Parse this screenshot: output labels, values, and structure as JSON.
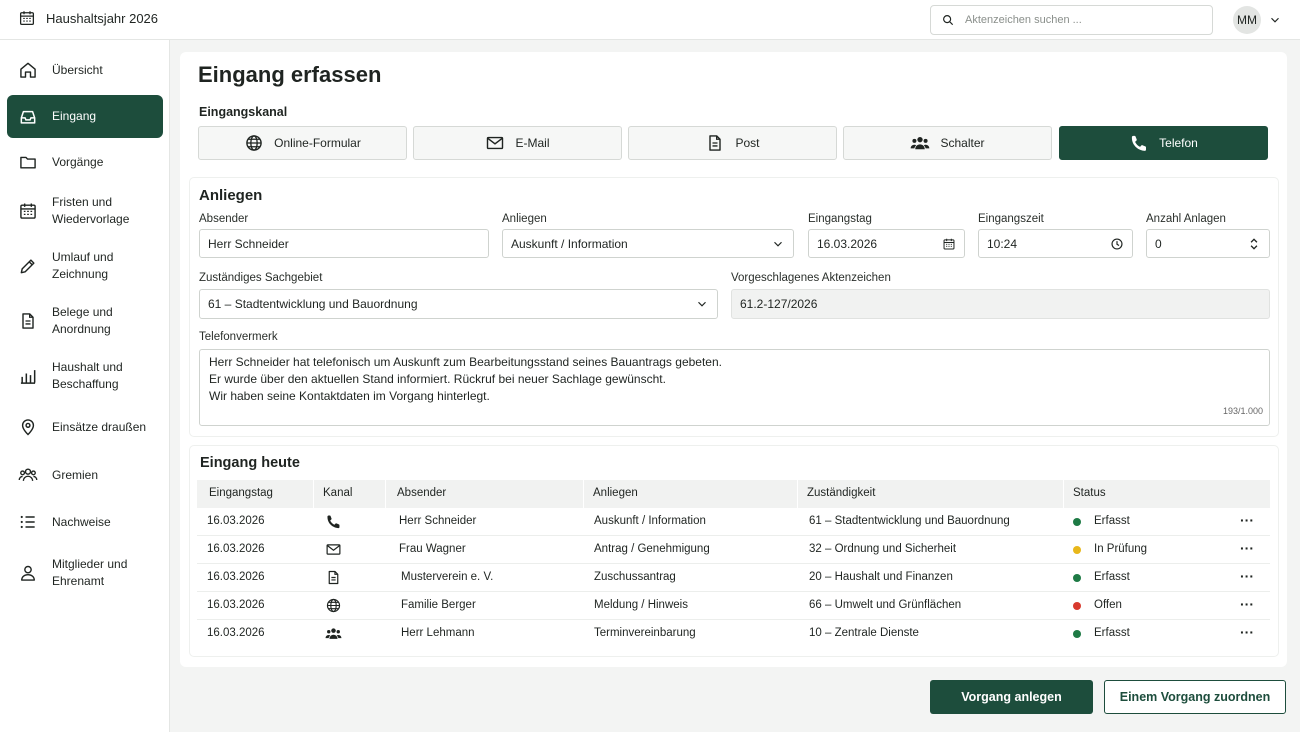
{
  "header": {
    "title": "Haushaltsjahr 2026",
    "search_placeholder": "Aktenzeichen suchen ...",
    "avatar_initials": "MM"
  },
  "sidebar": {
    "items": [
      {
        "label": "Übersicht",
        "icon": "home-icon"
      },
      {
        "label": "Eingang",
        "icon": "inbox-icon",
        "active": true
      },
      {
        "label": "Vorgänge",
        "icon": "folder-icon"
      },
      {
        "label": "Fristen und\nWiedervorlage",
        "icon": "calendar-icon"
      },
      {
        "label": "Umlauf und\nZeichnung",
        "icon": "pencil-icon"
      },
      {
        "label": "Belege und\nAnordnung",
        "icon": "document-icon"
      },
      {
        "label": "Haushalt und\nBeschaffung",
        "icon": "bar-chart-icon"
      },
      {
        "label": "Einsätze draußen",
        "icon": "location-pin-icon"
      },
      {
        "label": "Gremien",
        "icon": "people-icon"
      },
      {
        "label": "Nachweise",
        "icon": "list-icon"
      },
      {
        "label": "Mitglieder und\nEhrenamt",
        "icon": "user-icon"
      }
    ]
  },
  "page": {
    "title": "Eingang erfassen",
    "channel_section": "Eingangskanal",
    "channels": [
      {
        "label": "Online-Formular",
        "icon": "globe-icon"
      },
      {
        "label": "E-Mail",
        "icon": "mail-icon"
      },
      {
        "label": "Post",
        "icon": "document-icon"
      },
      {
        "label": "Schalter",
        "icon": "people-icon"
      },
      {
        "label": "Telefon",
        "icon": "phone-icon",
        "active": true
      }
    ]
  },
  "form": {
    "section": "Anliegen",
    "sender_label": "Absender",
    "sender_value": "Herr Schneider",
    "concern_label": "Anliegen",
    "concern_value": "Auskunft / Information",
    "date_label": "Eingangstag",
    "date_value": "16.03.2026",
    "time_label": "Eingangszeit",
    "time_value": "10:24",
    "attachments_label": "Anzahl Anlagen",
    "attachments_value": "0",
    "department_label": "Zuständiges Sachgebiet",
    "department_value": "61 – Stadtentwicklung und Bauordnung",
    "file_number_label": "Vorgeschlagenes Aktenzeichen",
    "file_number_value": "61.2-127/2026",
    "note_label": "Telefonvermerk",
    "note_lines": [
      "Herr Schneider hat telefonisch um Auskunft zum Bearbeitungsstand seines Bauantrags gebeten.",
      "Er wurde über den aktuellen Stand informiert. Rückruf bei neuer Sachlage gewünscht.",
      "Wir haben seine Kontaktdaten im Vorgang hinterlegt."
    ],
    "note_counter": "193/1.000"
  },
  "today": {
    "title": "Eingang heute",
    "columns": [
      "Eingangstag",
      "Kanal",
      "Absender",
      "Anliegen",
      "Zuständigkeit",
      "Status"
    ],
    "rows": [
      {
        "date": "16.03.2026",
        "channel_icon": "phone-icon",
        "sender": "Herr Schneider",
        "concern": "Auskunft / Information",
        "responsible": "61 – Stadtentwicklung und Bauordnung",
        "status": "Erfasst",
        "status_color": "#1e7a45"
      },
      {
        "date": "16.03.2026",
        "channel_icon": "mail-icon",
        "sender": "Frau Wagner",
        "concern": "Antrag / Genehmigung",
        "responsible": "32 – Ordnung und Sicherheit",
        "status": "In Prüfung",
        "status_color": "#e8b71a"
      },
      {
        "date": "16.03.2026",
        "channel_icon": "document-icon",
        "sender": "Musterverein e. V.",
        "concern": "Zuschussantrag",
        "responsible": "20 – Haushalt und Finanzen",
        "status": "Erfasst",
        "status_color": "#1e7a45"
      },
      {
        "date": "16.03.2026",
        "channel_icon": "globe-icon",
        "sender": "Familie Berger",
        "concern": "Meldung / Hinweis",
        "responsible": "66 – Umwelt und Grünflächen",
        "status": "Offen",
        "status_color": "#d83a2e"
      },
      {
        "date": "16.03.2026",
        "channel_icon": "people-icon",
        "sender": "Herr Lehmann",
        "concern": "Terminvereinbarung",
        "responsible": "10 – Zentrale Dienste",
        "status": "Erfasst",
        "status_color": "#1e7a45"
      }
    ],
    "more_label": "···"
  },
  "actions": {
    "primary": "Vorgang anlegen",
    "secondary": "Einem Vorgang zuordnen"
  },
  "colors": {
    "accent": "#1d4d3c"
  }
}
